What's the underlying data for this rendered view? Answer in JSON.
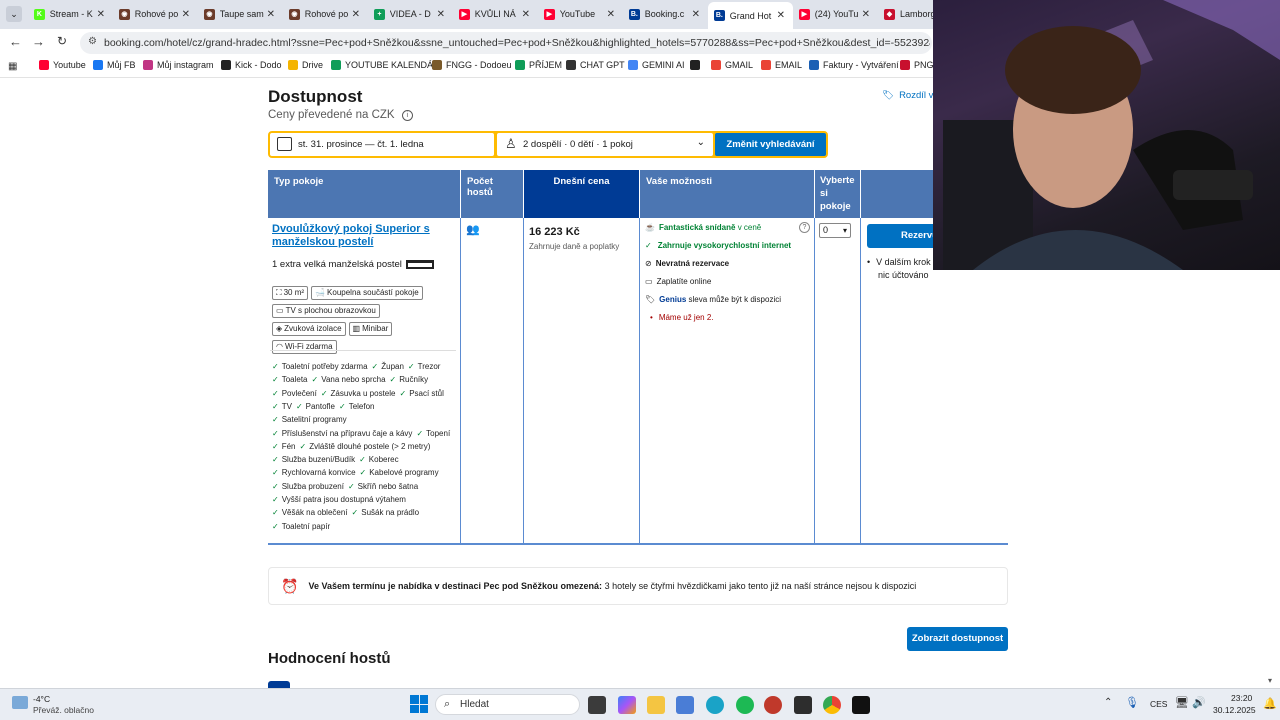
{
  "browser": {
    "tabs": [
      {
        "label": "Stream - K",
        "color": "#53fc18",
        "glyph": "K"
      },
      {
        "label": "Rohové po",
        "color": "#6b3b2a",
        "glyph": "◉"
      },
      {
        "label": "Taupe sam",
        "color": "#6b3b2a",
        "glyph": "◉"
      },
      {
        "label": "Rohové po",
        "color": "#6b3b2a",
        "glyph": "◉"
      },
      {
        "label": "VIDEA - D",
        "color": "#0f9d58",
        "glyph": "+"
      },
      {
        "label": "KVŮLI NÁ",
        "color": "#ff0033",
        "glyph": "▶"
      },
      {
        "label": "YouTube",
        "color": "#ff0033",
        "glyph": "▶"
      },
      {
        "label": "Booking.c",
        "color": "#003b95",
        "glyph": "B."
      },
      {
        "label": "Grand Hot",
        "color": "#003b95",
        "glyph": "B."
      },
      {
        "label": "(24) YouTu",
        "color": "#ff0033",
        "glyph": "▶"
      },
      {
        "label": "Lamborg",
        "color": "#c8102e",
        "glyph": "◆"
      }
    ],
    "url": "booking.com/hotel/cz/grand-hradec.html?ssne=Pec+pod+Sněžkou&ssne_untouched=Pec+pod+Sněžkou&highlighted_hotels=5770288&ss=Pec+pod+Sněžkou&dest_id=-552392&dest_type=city&hp_",
    "bookmarks": [
      {
        "label": "Youtube",
        "color": "#ff0033"
      },
      {
        "label": "Můj FB",
        "color": "#1877f2"
      },
      {
        "label": "Můj instagram",
        "color": "#c13584"
      },
      {
        "label": "Kick - Dodo",
        "color": "#222222"
      },
      {
        "label": "Drive",
        "color": "#f4b400"
      },
      {
        "label": "YOUTUBE KALENDÁŘ",
        "color": "#0f9d58"
      },
      {
        "label": "FNGG - Dodoeu",
        "color": "#7a5a2a"
      },
      {
        "label": "PŘÍJEM",
        "color": "#0f9d58"
      },
      {
        "label": "CHAT GPT",
        "color": "#333333"
      },
      {
        "label": "GEMINI AI",
        "color": "#4285f4"
      },
      {
        "label": "",
        "color": "#222222"
      },
      {
        "label": "GMAIL",
        "color": "#ea4335"
      },
      {
        "label": "EMAIL",
        "color": "#ea4335"
      },
      {
        "label": "Faktury - Vytváření",
        "color": "#1a5fb4"
      },
      {
        "label": "PNG",
        "color": "#c8102e"
      }
    ]
  },
  "page": {
    "heading": "Dostupnost",
    "subheading": "Ceny převedené na CZK",
    "compare_link": "Rozdíl v",
    "search": {
      "dates": "st. 31. prosince — čt. 1. ledna",
      "guests": "2 dospělí · 0 dětí · 1 pokoj",
      "button": "Změnit vyhledávání"
    },
    "table": {
      "headers": {
        "room_type": "Typ pokoje",
        "guests": "Počet hostů",
        "price": "Dnešní cena",
        "options": "Vaše možnosti",
        "select": "Vyberte si pokoje"
      },
      "room_name": "Dvoulůžkový pokoj Superior s manželskou postelí",
      "bed": "1 extra velká manželská postel",
      "amenities": [
        "30 m²",
        "Koupelna součástí pokoje",
        "TV s plochou obrazovkou",
        "Zvuková izolace",
        "Minibar",
        "Wi-Fi zdarma"
      ],
      "facilities": [
        [
          "Toaletní potřeby zdarma",
          "Župan",
          "Trezor"
        ],
        [
          "Toaleta",
          "Vana nebo sprcha",
          "Ručníky"
        ],
        [
          "Povlečení",
          "Zásuvka u postele",
          "Psací stůl"
        ],
        [
          "TV",
          "Pantofle",
          "Telefon"
        ],
        [
          "Satelitní programy"
        ],
        [
          "Příslušenství na přípravu čaje a kávy",
          "Topení"
        ],
        [
          "Fén",
          "Zvláště dlouhé postele (> 2 metry)"
        ],
        [
          "Služba buzení/Budík",
          "Koberec"
        ],
        [
          "Rychlovarná konvice",
          "Kabelové programy"
        ],
        [
          "Služba probuzení",
          "Skříň nebo šatna"
        ],
        [
          "Vyšší patra jsou dostupná výtahem"
        ],
        [
          "Věšák na oblečení",
          "Sušák na prádlo"
        ],
        [
          "Toaletní papír"
        ]
      ],
      "price": "16 223 Kč",
      "price_note": "Zahrnuje daně a poplatky",
      "options": {
        "breakfast_bold": "Fantastická snídaně",
        "breakfast_rest": "v ceně",
        "internet": "Zahrnuje vysokorychlostní internet",
        "nonrefundable": "Nevratná rezervace",
        "pay_online": "Zaplatíte online",
        "genius_bold": "Genius",
        "genius_rest": "sleva může být k dispozici",
        "only_left": "Máme už jen 2."
      },
      "select_value": "0",
      "reserve_button": "Rezervu",
      "next_step_1": "V dalším krok",
      "next_step_2": "nic účtováno"
    },
    "notice_bold": "Ve Vašem termínu je nabídka v destinaci Pec pod Sněžkou omezená:",
    "notice_rest": "3 hotely se čtyřmi hvězdičkami jako tento již na naší stránce nejsou k dispozici",
    "show_availability": "Zobrazit dostupnost",
    "reviews_heading": "Hodnocení hostů"
  },
  "taskbar": {
    "weather_temp": "-4°C",
    "weather_desc": "Převáž. oblačno",
    "search_placeholder": "Hledat",
    "lang": "CES",
    "time": "23:20",
    "date": "30.12.2025"
  }
}
